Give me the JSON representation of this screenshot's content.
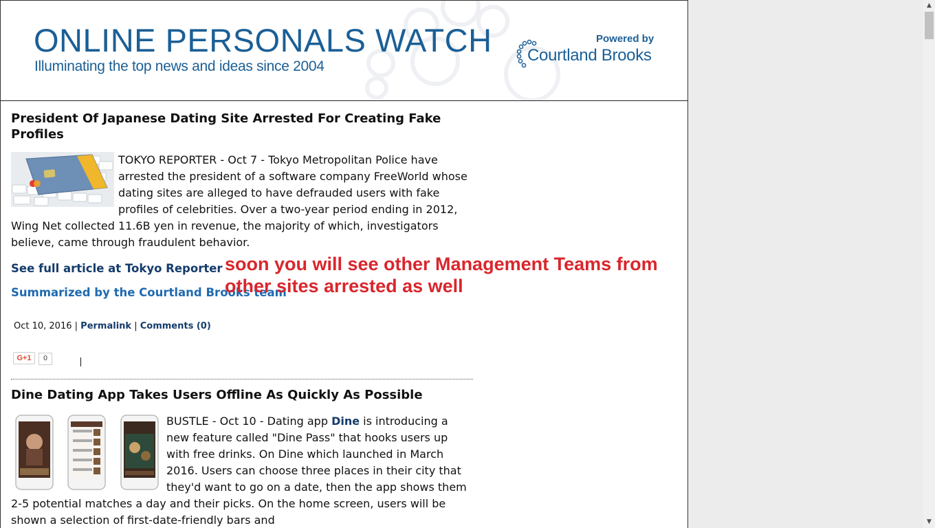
{
  "header": {
    "title_part1": "ONLINE",
    "title_part2": "PERSONALS WATCH",
    "tagline": "Illuminating the top news and ideas since 2004",
    "powered_by": "Powered by",
    "sponsor": "Courtland Brooks"
  },
  "post1": {
    "title": "President Of Japanese Dating Site Arrested For Creating Fake Profiles",
    "body": "TOKYO REPORTER - Oct 7 - Tokyo Metropolitan Police have arrested the president of a software company FreeWorld whose dating sites are alleged to have defrauded users with fake profiles of celebrities. Over a two-year period ending in 2012, Wing Net collected 11.6B yen in revenue, the majority of which, investigators believe, came through fraudulent behavior.",
    "full_article_link": "See full article at Tokyo Reporter",
    "summary_link": "Summarized by the Courtland Brooks team",
    "date": "Oct 10, 2016",
    "separator": "|",
    "permalink": "Permalink",
    "comments": "Comments (0)",
    "gplus_label": "G+1",
    "gplus_count": "0"
  },
  "annotation": "soon you will see other Management Teams from other sites arrested as well",
  "post2": {
    "title": "Dine Dating App Takes Users Offline As Quickly As Possible",
    "body_before": "BUSTLE - Oct 10 - Dating app ",
    "body_link": "Dine",
    "body_after": " is introducing a new feature called \"Dine Pass\" that hooks users up with free drinks. On Dine which launched in March 2016. Users can choose three places in their city that they'd want to go on a date, then the app shows them 2-5 potential matches a day and their picks. On the home screen, users will be shown a selection of first-date-friendly bars and"
  },
  "colors": {
    "brand_blue": "#1b5f96",
    "link_dark": "#153c6b",
    "link_mid": "#1f6ab0",
    "annotation_red": "#d9262c"
  },
  "icons": {
    "scroll_up": "chevron-up-icon",
    "scroll_down": "chevron-down-icon"
  }
}
